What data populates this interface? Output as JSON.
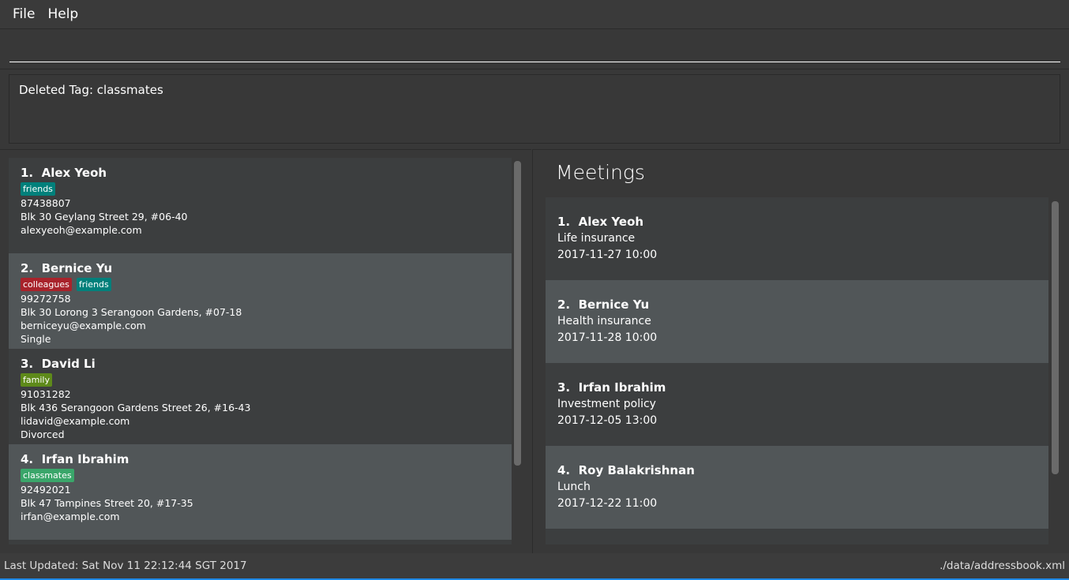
{
  "menu": {
    "file": "File",
    "help": "Help"
  },
  "command": {
    "value": "",
    "placeholder": ""
  },
  "result": "Deleted Tag: classmates",
  "persons": [
    {
      "index": "1.",
      "name": "Alex Yeoh",
      "tags": [
        {
          "label": "friends",
          "color": "#00807b"
        }
      ],
      "phone": "87438807",
      "address": "Blk 30 Geylang Street 29, #06-40",
      "email": "alexyeoh@example.com",
      "status": ""
    },
    {
      "index": "2.",
      "name": "Bernice Yu",
      "tags": [
        {
          "label": "colleagues",
          "color": "#a8232b"
        },
        {
          "label": "friends",
          "color": "#00807b"
        }
      ],
      "phone": "99272758",
      "address": "Blk 30 Lorong 3 Serangoon Gardens, #07-18",
      "email": "berniceyu@example.com",
      "status": "Single"
    },
    {
      "index": "3.",
      "name": "David Li",
      "tags": [
        {
          "label": "family",
          "color": "#5e8a1a"
        }
      ],
      "phone": "91031282",
      "address": "Blk 436 Serangoon Gardens Street 26, #16-43",
      "email": "lidavid@example.com",
      "status": "Divorced"
    },
    {
      "index": "4.",
      "name": "Irfan Ibrahim",
      "tags": [
        {
          "label": "classmates",
          "color": "#3aa66a"
        }
      ],
      "phone": "92492021",
      "address": "Blk 47 Tampines Street 20, #17-35",
      "email": "irfan@example.com",
      "status": ""
    }
  ],
  "meetings": {
    "title": "Meetings",
    "items": [
      {
        "index": "1.",
        "name": "Alex Yeoh",
        "description": "Life insurance",
        "datetime": "2017-11-27 10:00"
      },
      {
        "index": "2.",
        "name": "Bernice Yu",
        "description": "Health insurance",
        "datetime": "2017-11-28 10:00"
      },
      {
        "index": "3.",
        "name": "Irfan Ibrahim",
        "description": "Investment policy",
        "datetime": "2017-12-05 13:00"
      },
      {
        "index": "4.",
        "name": "Roy Balakrishnan",
        "description": "Lunch",
        "datetime": "2017-12-22 11:00"
      }
    ]
  },
  "status": {
    "last_updated": "Last Updated: Sat Nov 11 22:12:44 SGT 2017",
    "path": "./data/addressbook.xml"
  }
}
